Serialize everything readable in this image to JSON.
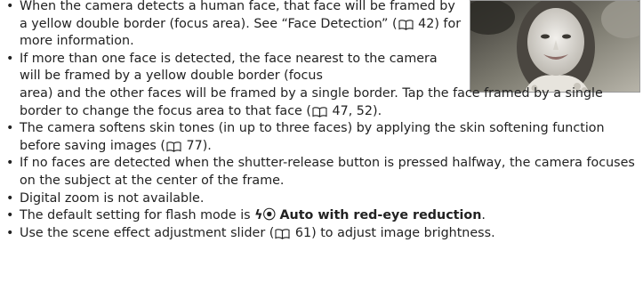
{
  "bullets": [
    {
      "segments": [
        "When the camera detects a human face, that face will be framed by a yellow double border (focus area). See “Face Detection” (",
        " 42) for more information."
      ]
    },
    {
      "line1": "If more than one face is detected, the face nearest to the camera will be framed by a yellow double border (focus",
      "line2_segments": [
        "area) and the other faces will be framed by a single border. Tap the face framed by a single border to change the focus area to that face (",
        " 47, 52)."
      ]
    },
    {
      "segments": [
        "The camera softens skin tones (in up to three faces) by applying the skin softening function before saving images (",
        " 77)."
      ]
    },
    {
      "text": "If no faces are detected when the shutter-release button is pressed halfway, the camera focuses on the subject at the center of the frame."
    },
    {
      "text": "Digital zoom is not available."
    },
    {
      "prefix": "The default setting for flash mode is ",
      "mode_icon": "ϟ⦿",
      "mode_label": "Auto with red-eye reduction",
      "suffix": "."
    },
    {
      "segments": [
        "Use the scene effect adjustment slider (",
        " 61) to adjust image brightness."
      ]
    }
  ],
  "icons": {
    "reference": "book-reference-icon",
    "flash": "flash-red-eye-icon"
  },
  "photo": {
    "subject": "smiling-child-portrait"
  }
}
